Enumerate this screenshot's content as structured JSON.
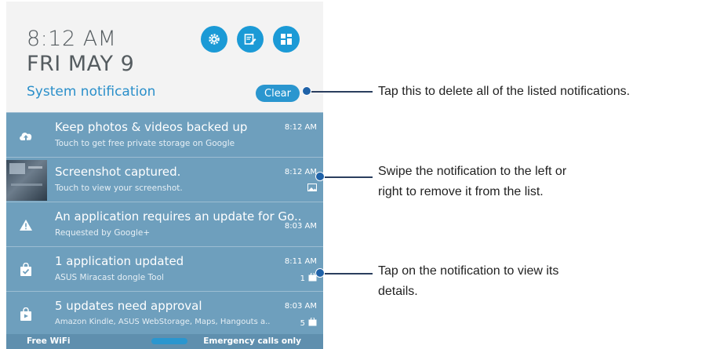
{
  "header": {
    "time": "8:12 AM",
    "date": "FRI MAY 9",
    "system_notification": "System notification",
    "clear_label": "Clear"
  },
  "quick_icons": [
    "settings-icon",
    "edit-icon",
    "grid-icon"
  ],
  "notifications": [
    {
      "icon": "cloud-upload-icon",
      "title": "Keep photos & videos backed up",
      "subtitle": "Touch to get free private storage on Google",
      "time": "8:12 AM"
    },
    {
      "icon": "screenshot-thumbnail",
      "title": "Screenshot captured.",
      "subtitle": "Touch to view your screenshot.",
      "time": "8:12 AM",
      "extra_icon": "image-icon"
    },
    {
      "icon": "warning-icon",
      "title": "An application requires an update for Go..",
      "subtitle": "Requested by Google+",
      "time": "8:03 AM"
    },
    {
      "icon": "store-check-icon",
      "title": "1 application updated",
      "subtitle": "ASUS Miracast dongle Tool",
      "time": "8:11 AM",
      "count": "1",
      "extra_icon": "store-icon"
    },
    {
      "icon": "store-update-icon",
      "title": "5 updates need approval",
      "subtitle": "Amazon Kindle, ASUS WebStorage, Maps, Hangouts a..",
      "time": "8:03 AM",
      "count": "5",
      "extra_icon": "store-icon"
    }
  ],
  "bottom_bar": {
    "wifi": "Free WiFi",
    "emergency": "Emergency calls only"
  },
  "callouts": [
    "Tap this to delete all of the listed notifications.",
    "Swipe the notification to the left or",
    "right to remove it from the list.",
    "Tap on the notification to view its",
    "details."
  ],
  "colors": {
    "accent": "#2a96cf",
    "notification_bg": "#6e9fbd",
    "header_bg": "#f3f3f3"
  }
}
